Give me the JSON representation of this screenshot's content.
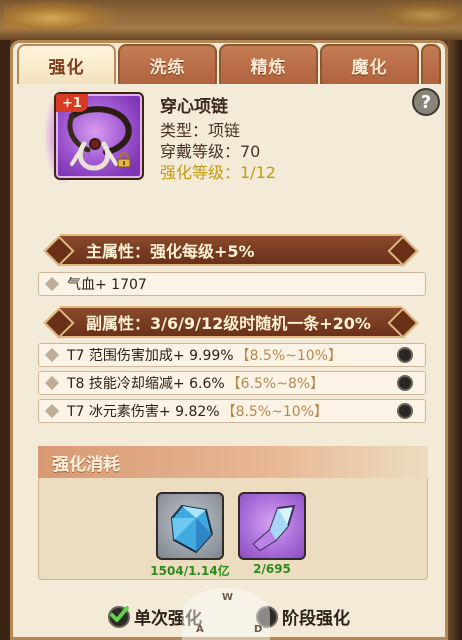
{
  "tabs": [
    {
      "label": "强化",
      "active": true
    },
    {
      "label": "洗练",
      "active": false
    },
    {
      "label": "精炼",
      "active": false
    },
    {
      "label": "魔化",
      "active": false
    }
  ],
  "item": {
    "badge": "+1",
    "name": "穿心项链",
    "type_line": "类型：项链",
    "wear_line": "穿戴等级：70",
    "enhance_line": "强化等级：1/12",
    "icon": "necklace-icon",
    "rarity_color": "#a25ad2"
  },
  "help_label": "?",
  "main_attr": {
    "title": "主属性：",
    "value": "强化每级+5%"
  },
  "main_stats": [
    {
      "text": "气血+ 1707"
    }
  ],
  "sub_attr": {
    "title": "副属性：",
    "value": "3/6/9/12级时随机一条+20%"
  },
  "sub_stats": [
    {
      "text": "T7 范围伤害加成+ 9.99%",
      "range": "【8.5%~10%】"
    },
    {
      "text": "T8 技能冷却缩减+ 6.6%",
      "range": "【6.5%~8%】"
    },
    {
      "text": "T7 冰元素伤害+ 9.82%",
      "range": "【8.5%~10%】"
    }
  ],
  "cost": {
    "title": "强化消耗",
    "materials": [
      {
        "icon": "blue-crystal-icon",
        "count": "1504/1.14亿"
      },
      {
        "icon": "purple-crystal-icon",
        "count": "2/695"
      }
    ]
  },
  "options": {
    "single": "单次强化",
    "stage": "阶段强化"
  },
  "joystick": {
    "w": "W",
    "a": "A",
    "d": "D"
  },
  "colors": {
    "accent": "#6a3018",
    "gold_text": "#c49a13",
    "count_green": "#2d8a1c"
  }
}
